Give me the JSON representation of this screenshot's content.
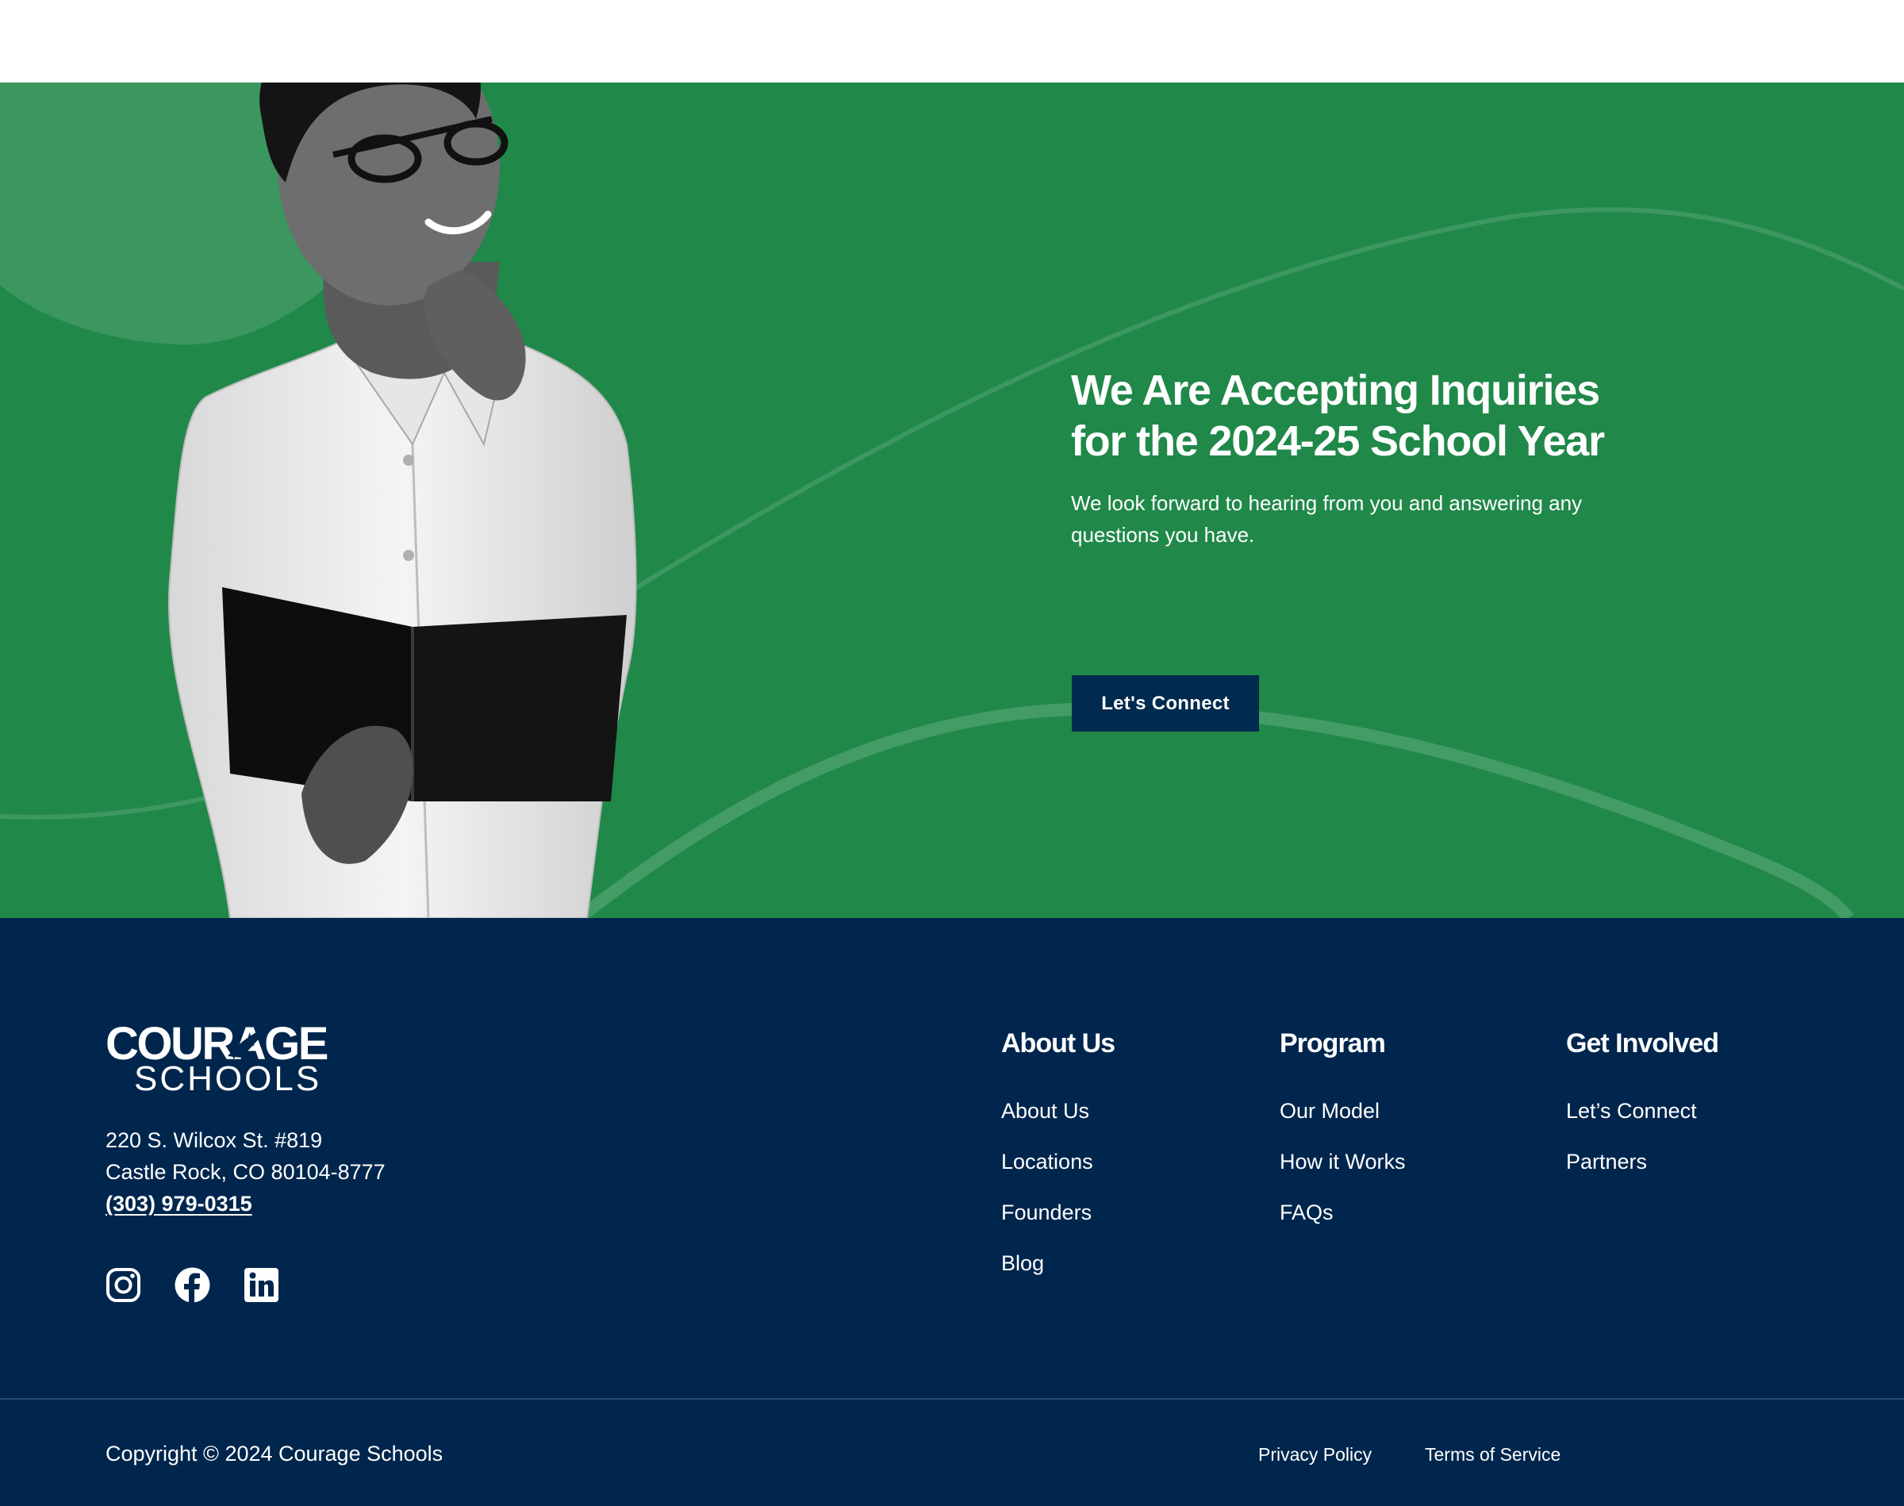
{
  "hero": {
    "title_line1": "We Are Accepting Inquiries",
    "title_line2": "for the 2024-25 School Year",
    "subtitle": "We look forward to hearing from you and answering any questions you have.",
    "cta_label": "Let's Connect",
    "background_color": "#208849"
  },
  "footer": {
    "background_color": "#00264d",
    "logo": {
      "top": "COURAGE",
      "bottom": "SCHOOLS"
    },
    "address_line1": "220 S. Wilcox St. #819",
    "address_line2": "Castle Rock, CO 80104-8777",
    "phone": "(303) 979-0315",
    "social": [
      "instagram-icon",
      "facebook-icon",
      "linkedin-icon"
    ],
    "columns": [
      {
        "title": "About Us",
        "links": [
          "About Us",
          "Locations",
          "Founders",
          "Blog"
        ]
      },
      {
        "title": "Program",
        "links": [
          "Our Model",
          "How it Works",
          "FAQs"
        ]
      },
      {
        "title": "Get Involved",
        "links": [
          "Let’s Connect",
          "Partners"
        ]
      }
    ],
    "copyright": "Copyright © 2024 Courage Schools",
    "privacy": "Privacy Policy",
    "terms": "Terms of Service"
  }
}
